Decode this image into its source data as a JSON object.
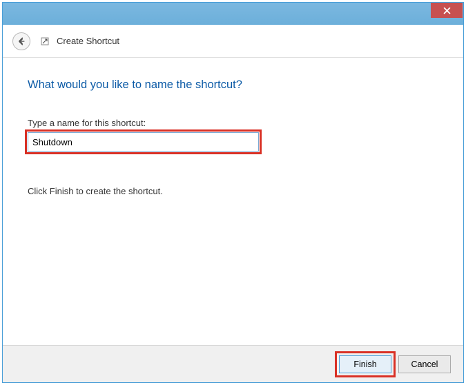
{
  "titlebar": {
    "close_label": "Close"
  },
  "header": {
    "title": "Create Shortcut"
  },
  "content": {
    "heading": "What would you like to name the shortcut?",
    "field_label": "Type a name for this shortcut:",
    "input_value": "Shutdown",
    "instruction": "Click Finish to create the shortcut."
  },
  "footer": {
    "finish_label": "Finish",
    "cancel_label": "Cancel"
  }
}
